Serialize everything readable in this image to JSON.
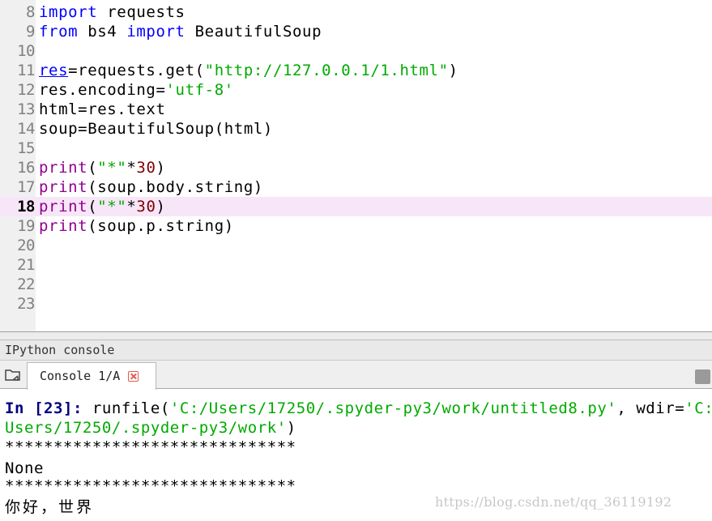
{
  "editor": {
    "lines": [
      {
        "number": "8",
        "code": "import requests"
      },
      {
        "number": "9",
        "code": "from bs4 import BeautifulSoup"
      },
      {
        "number": "10",
        "code": ""
      },
      {
        "number": "11",
        "code": "res=requests.get(\"http://127.0.0.1/1.html\")"
      },
      {
        "number": "12",
        "code": "res.encoding='utf-8'"
      },
      {
        "number": "13",
        "code": "html=res.text"
      },
      {
        "number": "14",
        "code": "soup=BeautifulSoup(html)"
      },
      {
        "number": "15",
        "code": ""
      },
      {
        "number": "16",
        "code": "print(\"*\"*30)"
      },
      {
        "number": "17",
        "code": "print(soup.body.string)"
      },
      {
        "number": "18",
        "code": "print(\"*\"*30)"
      },
      {
        "number": "19",
        "code": "print(soup.p.string)"
      },
      {
        "number": "20",
        "code": ""
      },
      {
        "number": "21",
        "code": ""
      },
      {
        "number": "22",
        "code": ""
      },
      {
        "number": "23",
        "code": ""
      }
    ],
    "current_line": "18",
    "tokens": {
      "import": "import",
      "from": "from",
      "requests": " requests",
      "bs4": " bs4 ",
      "beautifulsoup": " BeautifulSoup",
      "res": "res",
      "requests_get": "=requests.get(",
      "url": "\"http://127.0.0.1/1.html\"",
      "close_paren": ")",
      "res_encoding": "res.encoding=",
      "utf8": "'utf-8'",
      "html_assign": "html=res.text",
      "soup_assign": "soup=BeautifulSoup(html)",
      "print": "print",
      "open_paren": "(",
      "star_str": "\"*\"",
      "times": "*",
      "thirty": "30",
      "body_string": "(soup.body.string)",
      "p_string": "(soup.p.string)"
    }
  },
  "ipython": {
    "pane_title": "IPython console",
    "tab_label": "Console 1/A"
  },
  "console": {
    "prompt_in": "In [",
    "prompt_num": "23",
    "prompt_end": "]:",
    "runfile": " runfile(",
    "path_arg": "'C:/Users/17250/.spyder-py3/work/untitled8.py'",
    "wdir": ", wdir=",
    "wdir_start": "'C:",
    "wdir_rest": "Users/17250/.spyder-py3/work'",
    "close": ")",
    "stars": "******************************",
    "none": "None",
    "hello": "你好，世界"
  },
  "watermark": "https://blog.csdn.net/qq_36119192",
  "colors": {
    "keyword": "#0000ff",
    "builtin": "#900090",
    "string": "#00aa00",
    "number": "#800000",
    "current_line_bg": "#f7e6f7"
  }
}
